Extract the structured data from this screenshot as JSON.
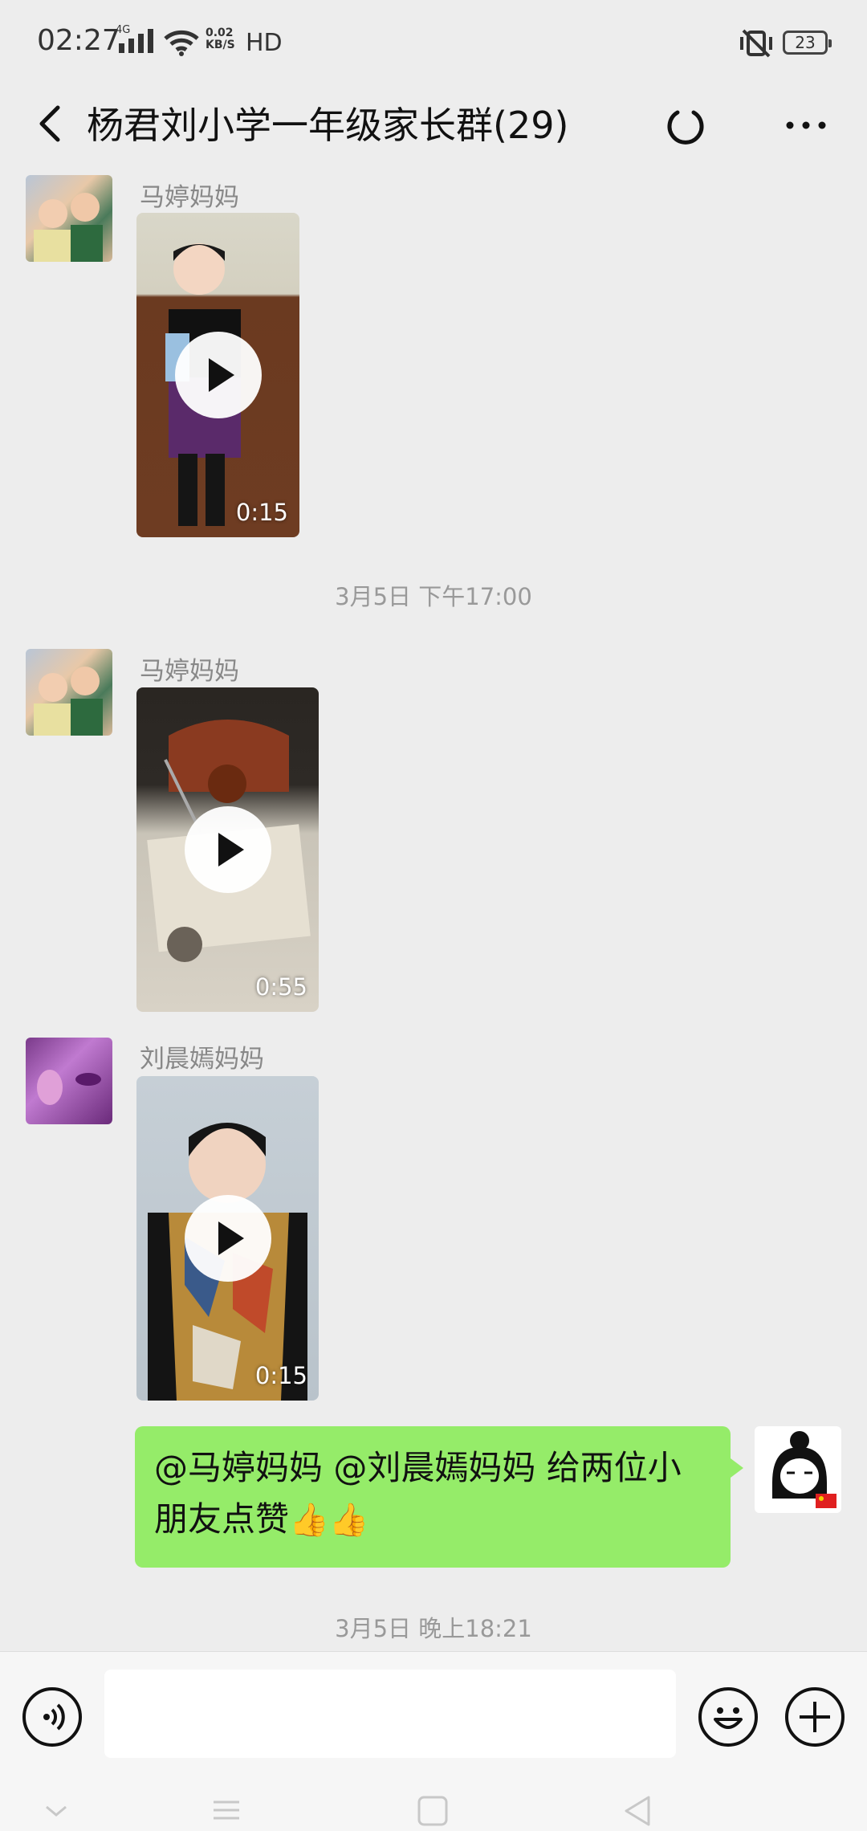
{
  "status_bar": {
    "time": "02:27",
    "network": "4G",
    "net_speed_value": "0.02",
    "net_speed_unit": "KB/S",
    "hd": "HD",
    "battery": "23"
  },
  "header": {
    "title": "杨君刘小学一年级家长群(29)"
  },
  "messages": [
    {
      "sender": "马婷妈妈",
      "duration": "0:15"
    },
    {
      "timestamp": "3月5日 下午17:00"
    },
    {
      "sender": "马婷妈妈",
      "duration": "0:55"
    },
    {
      "sender": "刘晨嫣妈妈",
      "duration": "0:15"
    },
    {
      "text": "@马婷妈妈 @刘晨嫣妈妈  给两位小朋友点赞",
      "emoji": "👍👍"
    },
    {
      "timestamp": "3月5日 晚上18:21"
    }
  ],
  "colors": {
    "background": "#ededed",
    "outgoing_bubble": "#95ec69",
    "timestamp_text": "#999999"
  }
}
